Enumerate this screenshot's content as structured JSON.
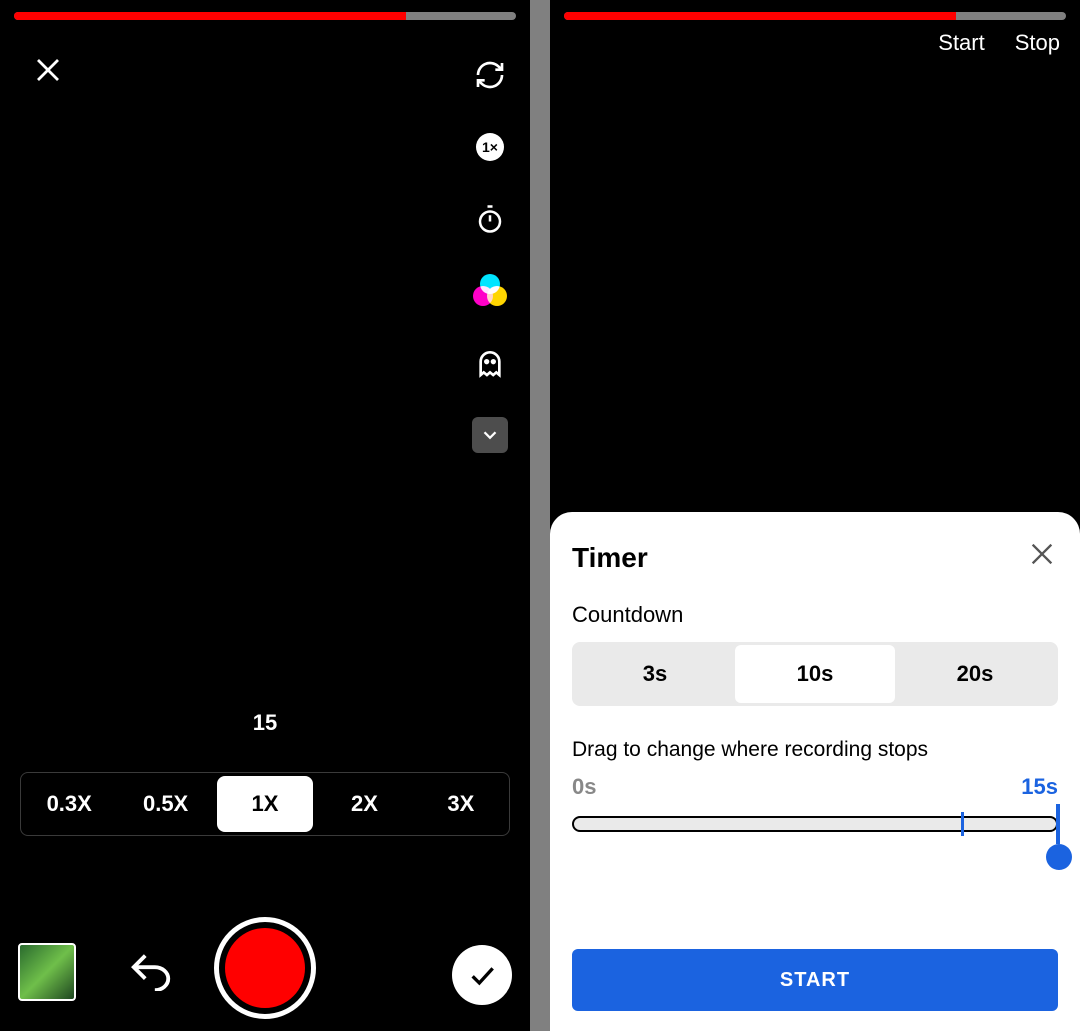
{
  "left": {
    "progress_percent": 78,
    "speed_badge": "1×",
    "counter": "15",
    "speeds": [
      "0.3X",
      "0.5X",
      "1X",
      "2X",
      "3X"
    ],
    "selected_speed_index": 2
  },
  "right": {
    "progress_percent": 78,
    "header": {
      "start": "Start",
      "stop": "Stop"
    },
    "sheet": {
      "title": "Timer",
      "countdown_label": "Countdown",
      "countdown_options": [
        "3s",
        "10s",
        "20s"
      ],
      "selected_countdown_index": 1,
      "drag_label": "Drag to change where recording stops",
      "range_min": "0s",
      "range_max": "15s",
      "start_button": "START"
    }
  }
}
